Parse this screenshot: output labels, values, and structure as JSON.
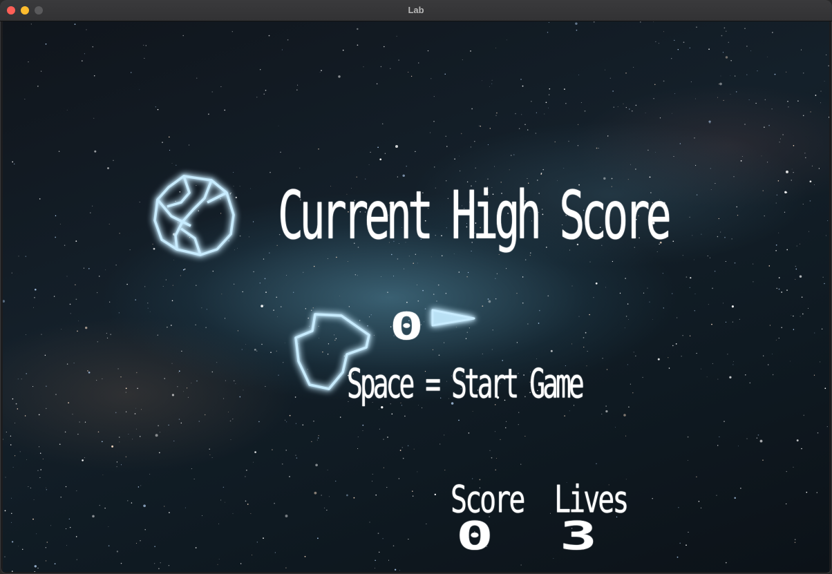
{
  "window": {
    "title": "Lab"
  },
  "hud": {
    "high_score_title": "Current High Score",
    "high_score_value": "0",
    "start_hint": "Space = Start Game",
    "score_label": "Score",
    "score_value": "0",
    "lives_label": "Lives",
    "lives_value": "3"
  },
  "colors": {
    "glow": "#a8dcf5",
    "text": "#ffffff",
    "close": "#ff5f57",
    "minimize": "#febc2e"
  },
  "icons": {
    "ship": "ship-icon",
    "asteroid_large": "asteroid-icon",
    "asteroid_medium": "asteroid-icon"
  }
}
